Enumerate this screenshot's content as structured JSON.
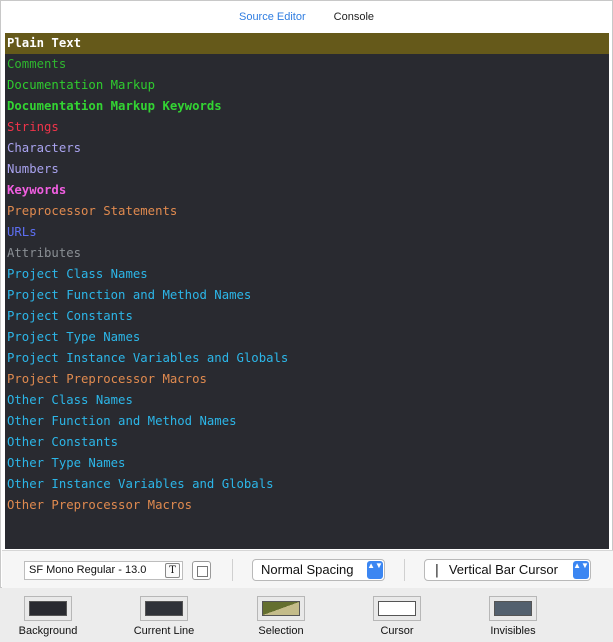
{
  "tabs": {
    "source_editor": "Source Editor",
    "console": "Console"
  },
  "editor": {
    "rows": [
      {
        "label": "Plain Text",
        "color": "#ffffff",
        "bold": true,
        "selected": true
      },
      {
        "label": "Comments",
        "color": "#2fb72f",
        "bold": false
      },
      {
        "label": "Documentation Markup",
        "color": "#2fcc2f",
        "bold": false
      },
      {
        "label": "Documentation Markup Keywords",
        "color": "#33d433",
        "bold": true
      },
      {
        "label": "Strings",
        "color": "#f0344a",
        "bold": false
      },
      {
        "label": "Characters",
        "color": "#a9a3ef",
        "bold": false
      },
      {
        "label": "Numbers",
        "color": "#a9a3ef",
        "bold": false
      },
      {
        "label": "Keywords",
        "color": "#f05ee0",
        "bold": true
      },
      {
        "label": "Preprocessor Statements",
        "color": "#e08a4f",
        "bold": false
      },
      {
        "label": "URLs",
        "color": "#5d6ff2",
        "bold": false
      },
      {
        "label": "Attributes",
        "color": "#8a8f94",
        "bold": false
      },
      {
        "label": "Project Class Names",
        "color": "#2cb6e8",
        "bold": false
      },
      {
        "label": "Project Function and Method Names",
        "color": "#2cb6e8",
        "bold": false
      },
      {
        "label": "Project Constants",
        "color": "#2cb6e8",
        "bold": false
      },
      {
        "label": "Project Type Names",
        "color": "#2cb6e8",
        "bold": false
      },
      {
        "label": "Project Instance Variables and Globals",
        "color": "#2cb6e8",
        "bold": false
      },
      {
        "label": "Project Preprocessor Macros",
        "color": "#e08a4f",
        "bold": false
      },
      {
        "label": "Other Class Names",
        "color": "#2cb6e8",
        "bold": false
      },
      {
        "label": "Other Function and Method Names",
        "color": "#2cb6e8",
        "bold": false
      },
      {
        "label": "Other Constants",
        "color": "#2cb6e8",
        "bold": false
      },
      {
        "label": "Other Type Names",
        "color": "#2cb6e8",
        "bold": false
      },
      {
        "label": "Other Instance Variables and Globals",
        "color": "#2cb6e8",
        "bold": false
      },
      {
        "label": "Other Preprocessor Macros",
        "color": "#e08a4f",
        "bold": false
      }
    ]
  },
  "bottom_bar": {
    "font_value": "SF Mono Regular - 13.0",
    "font_button_icon": "T",
    "spacing_value": "Normal Spacing",
    "cursor_value": "Vertical Bar Cursor",
    "cursor_glyph": "|",
    "stepper_glyph": "▲▼"
  },
  "swatches": {
    "background": {
      "label": "Background",
      "color": "#292a30"
    },
    "current_line": {
      "label": "Current Line",
      "color": "#2f3239"
    },
    "selection": {
      "label": "Selection",
      "color": "#646f2f"
    },
    "cursor": {
      "label": "Cursor",
      "color": "#ffffff"
    },
    "invisibles": {
      "label": "Invisibles",
      "color": "#53606e"
    }
  }
}
